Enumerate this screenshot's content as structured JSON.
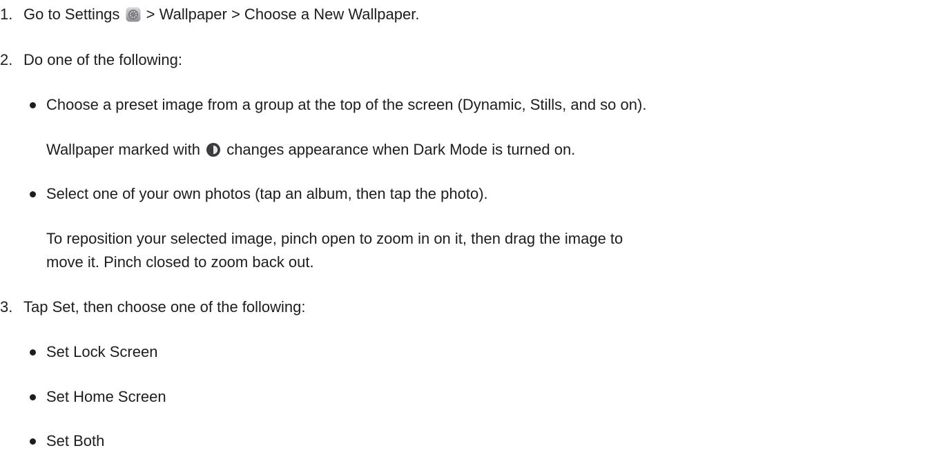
{
  "steps": [
    {
      "number": "1.",
      "text_before_icon": "Go to Settings",
      "icon": "settings-icon",
      "text_after_icon": "> Wallpaper > Choose a New Wallpaper."
    },
    {
      "number": "2.",
      "text": "Do one of the following:",
      "bullets": [
        {
          "text": "Choose a preset image from a group at the top of the screen (Dynamic, Stills, and so on).",
          "note_before_icon": "Wallpaper marked with",
          "note_icon": "dark-mode-icon",
          "note_after_icon": "changes appearance when Dark Mode is turned on."
        },
        {
          "text": "Select one of your own photos (tap an album, then tap the photo).",
          "note_line1": "To reposition your selected image, pinch open to zoom in on it, then drag the image to",
          "note_line2": "move it. Pinch closed to zoom back out."
        }
      ]
    },
    {
      "number": "3.",
      "text": "Tap Set, then choose one of the following:",
      "bullets": [
        {
          "text": "Set Lock Screen"
        },
        {
          "text": "Set Home Screen"
        },
        {
          "text": "Set Both"
        }
      ]
    }
  ]
}
